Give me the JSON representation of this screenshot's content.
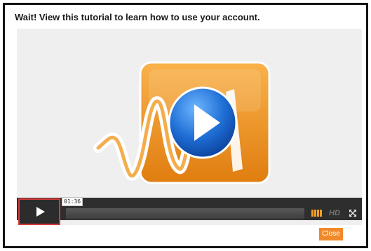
{
  "dialog": {
    "heading": "Wait! View this tutorial to learn how to use your account.",
    "close_label": "Close"
  },
  "player": {
    "time": "01:36",
    "hd_label": "HD",
    "progress": 0.0,
    "icons": {
      "play": "play-icon",
      "big_play": "big-play-icon",
      "volume": "volume-icon",
      "fullscreen": "fullscreen-icon"
    }
  },
  "colors": {
    "accent": "#f0892a",
    "highlight_border": "#d63a3a",
    "controls_bg": "#2e2e2e",
    "play_blue": "#1f6fd6"
  }
}
